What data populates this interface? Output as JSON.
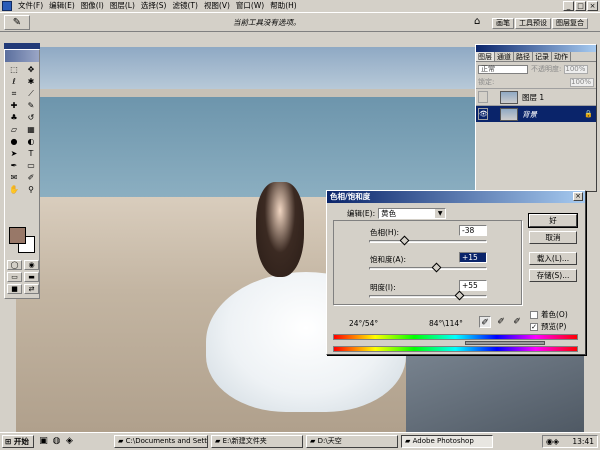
{
  "menubar": {
    "items": [
      "文件(F)",
      "编辑(E)",
      "图像(I)",
      "图层(L)",
      "选择(S)",
      "滤镜(T)",
      "视图(V)",
      "窗口(W)",
      "帮助(H)"
    ],
    "window_buttons": [
      "_",
      "□",
      "×"
    ]
  },
  "optionsbar": {
    "hint": "当前工具没有选项。",
    "well_tabs": [
      "画笔",
      "工具预设",
      "图层复合"
    ]
  },
  "layers_panel": {
    "tabs": [
      "图层",
      "通道",
      "路径",
      "记录",
      "动作"
    ],
    "blend_mode": "正常",
    "opacity_label": "不透明度:",
    "opacity_value": "100%",
    "lock_label": "锁定:",
    "fill_value": "100%",
    "layers": [
      {
        "name": "图层 1",
        "visible": false,
        "selected": false
      },
      {
        "name": "背景",
        "visible": true,
        "selected": true
      }
    ]
  },
  "dialog": {
    "title": "色相/饱和度",
    "edit_label": "编辑(E):",
    "edit_value": "黄色",
    "sliders": [
      {
        "label": "色相(H):",
        "value": "-38",
        "position": 0.3
      },
      {
        "label": "饱和度(A):",
        "value": "+15",
        "position": 0.57
      },
      {
        "label": "明度(I):",
        "value": "+55",
        "position": 0.76
      }
    ],
    "buttons": {
      "ok": "好",
      "cancel": "取消",
      "load": "载入(L)...",
      "save": "存储(S)..."
    },
    "colorize_label": "着色(O)",
    "colorize_checked": false,
    "preview_label": "预览(P)",
    "preview_checked": true,
    "range_left": "24°/54°",
    "range_right": "84°\\114°"
  },
  "taskbar": {
    "start": "开始",
    "tasks": [
      {
        "label": "C:\\Documents and Settin...",
        "active": false
      },
      {
        "label": "E:\\新建文件夹",
        "active": false
      },
      {
        "label": "D:\\天空",
        "active": false
      },
      {
        "label": "Adobe Photoshop",
        "active": true
      }
    ],
    "clock": "13:41"
  }
}
